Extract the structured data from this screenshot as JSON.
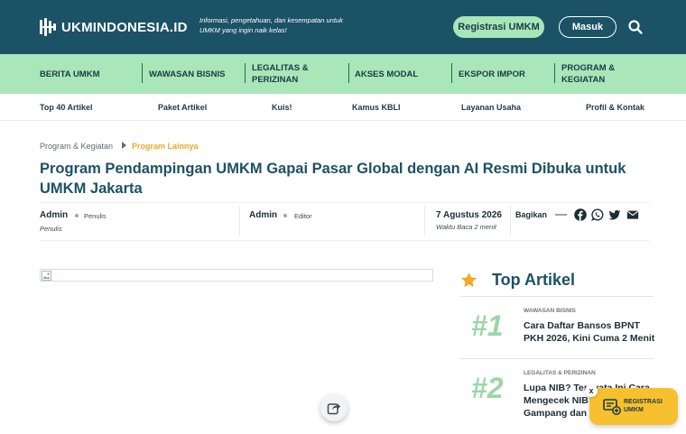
{
  "header": {
    "logo_text": "UKMINDONESIA.ID",
    "tagline": "Informasi, pengetahuan, dan kesempatan untuk UMKM yang ingin naik kelas!",
    "register_label": "Registrasi UMKM",
    "login_label": "Masuk",
    "search_icon": "search-icon",
    "colors": {
      "header_bg": "#1b5266",
      "nav_bg": "#a9e6b8",
      "accent": "#f5a623"
    }
  },
  "main_nav": {
    "items": [
      {
        "label": "BERITA UMKM"
      },
      {
        "label": "WAWASAN BISNIS"
      },
      {
        "label": "LEGALITAS & PERIZINAN"
      },
      {
        "label": "AKSES MODAL"
      },
      {
        "label": "EKSPOR IMPOR"
      },
      {
        "label": "PROGRAM & KEGIATAN"
      }
    ]
  },
  "sub_nav": {
    "items": [
      {
        "label": "Top 40 Artikel"
      },
      {
        "label": "Paket Artikel"
      },
      {
        "label": "Kuis!"
      },
      {
        "label": "Kamus KBLI"
      },
      {
        "label": "Layanan Usaha"
      },
      {
        "label": "Profil & Kontak"
      }
    ]
  },
  "breadcrumb": {
    "parent": "Program & Kegiatan",
    "current": "Program Lainnya"
  },
  "article": {
    "title": "Program Pendampingan UMKM Gapai Pasar Global dengan AI Resmi Dibuka untuk UMKM Jakarta",
    "author_1": {
      "name": "Admin",
      "role": "Penulis",
      "sub": "Penulis"
    },
    "author_2": {
      "name": "Admin",
      "role": "Editor"
    },
    "date": "7 Agustus 2026",
    "read_time": "Waktu Baca 2 menit",
    "share_label": "Bagikan",
    "share_icons": [
      "facebook-icon",
      "whatsapp-icon",
      "twitter-icon",
      "email-icon"
    ]
  },
  "sidebar": {
    "heading": "Top Artikel",
    "heading_icon": "star-icon",
    "articles": [
      {
        "rank": "#1",
        "category": "WAWASAN BISNIS",
        "title": "Cara Daftar Bansos BPNT PKH 2026, Kini Cuma 2 Menit"
      },
      {
        "rank": "#2",
        "category": "LEGALITAS & PERIZINAN",
        "title": "Lupa NIB? Ternyata Ini Cara Mengecek NIB dengan Gampang dan Praktis"
      }
    ]
  },
  "floating": {
    "register_text": "REGISTRASI UMKM",
    "close_label": "x",
    "share_icon": "share-icon"
  }
}
